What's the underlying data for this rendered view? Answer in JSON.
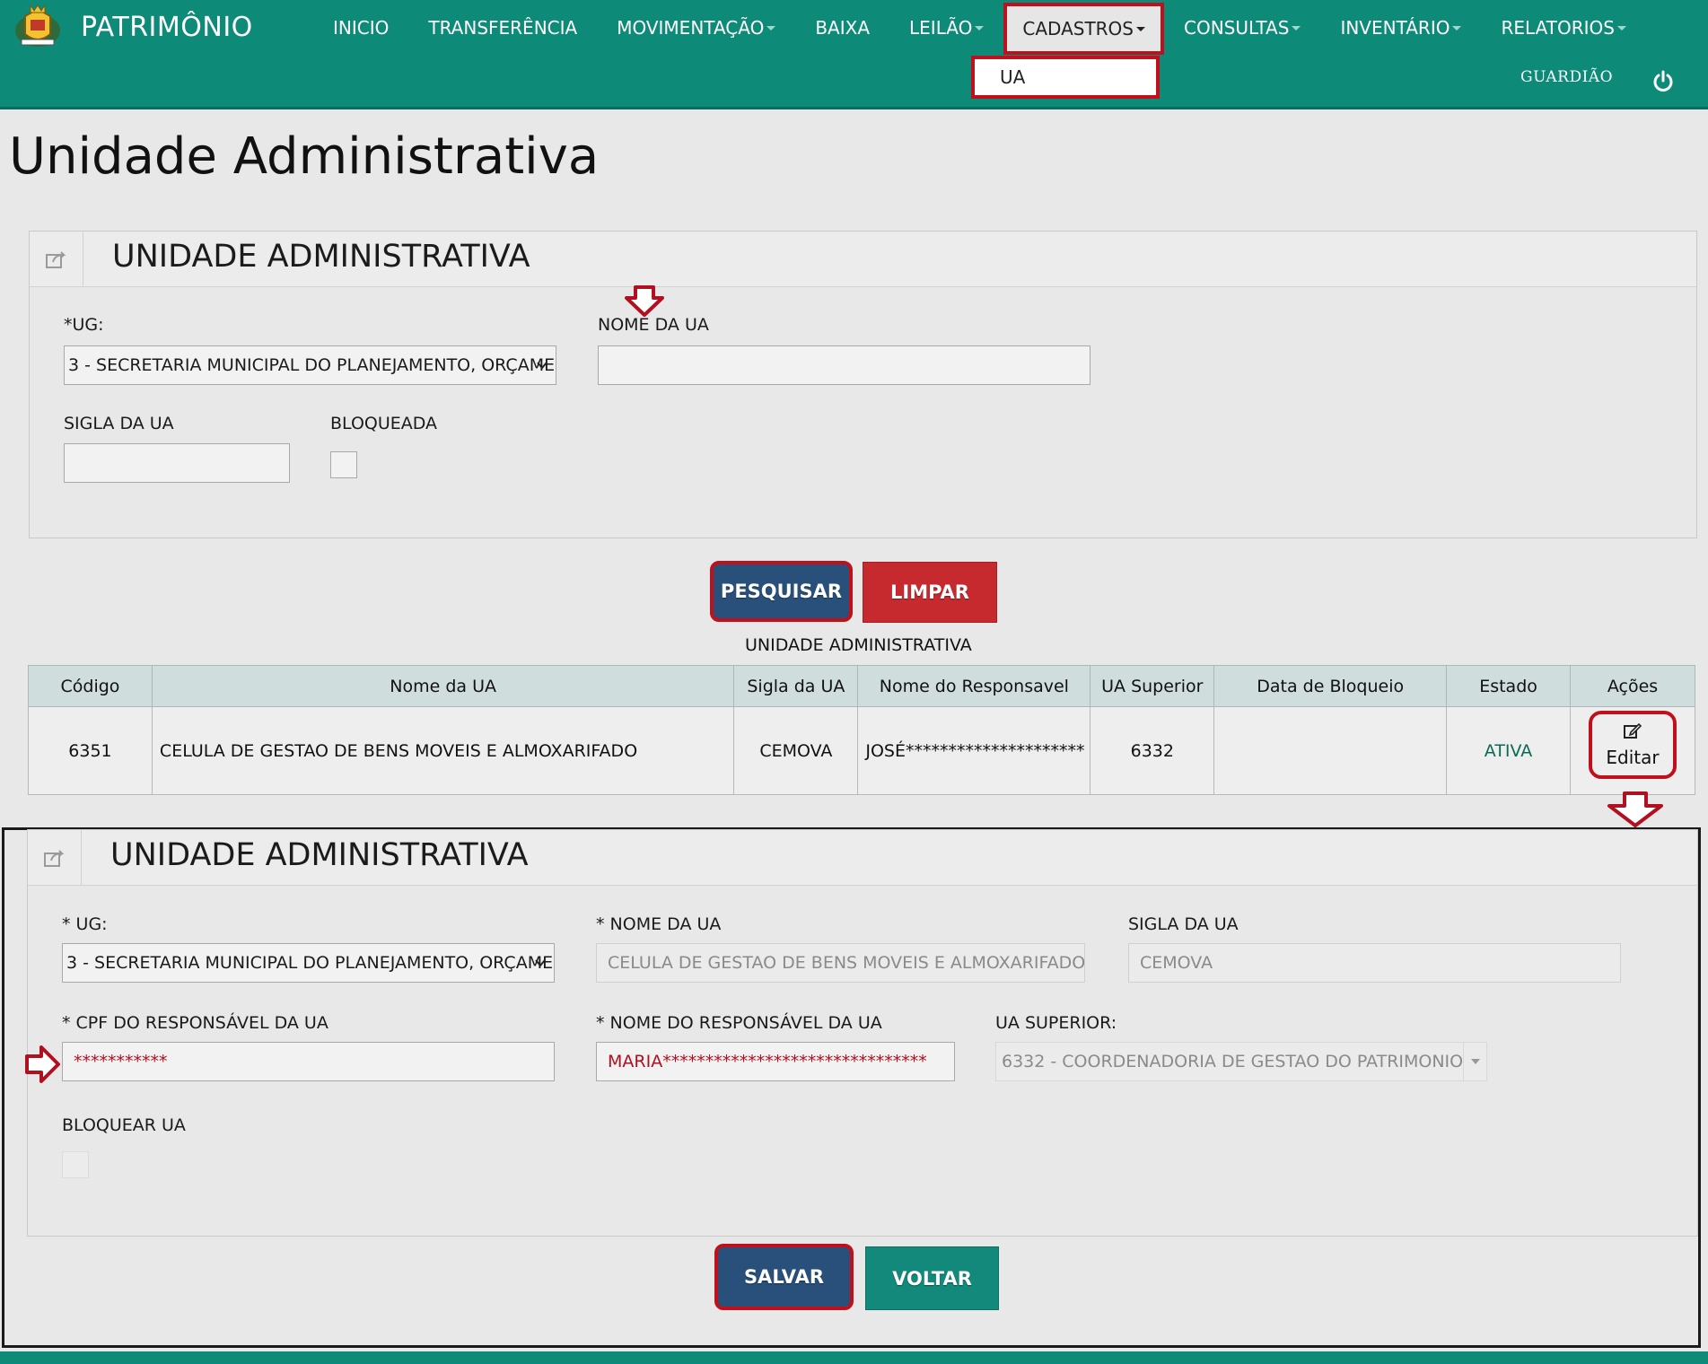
{
  "app": {
    "title": "PATRIMÔNIO",
    "user": "GUARDIÃO"
  },
  "icons": {
    "logo": "municipal-crest-icon",
    "power": "power-icon",
    "panel": "share-icon",
    "edit": "edit-icon"
  },
  "colors": {
    "navbar": "#0e8a78",
    "highlight": "#c0101c",
    "primary": "#28507a",
    "danger": "#c62a2f",
    "teal": "#12897b"
  },
  "nav": {
    "inicio": "INICIO",
    "transferencia": "TRANSFERÊNCIA",
    "movimentacao": "MOVIMENTAÇÃO",
    "baixa": "BAIXA",
    "leilao": "LEILÃO",
    "cadastros": "CADASTROS",
    "consultas": "CONSULTAS",
    "inventario": "INVENTÁRIO",
    "relatorios": "RELATORIOS",
    "cadastros_dropdown": [
      "UA"
    ]
  },
  "page": {
    "title": "Unidade Administrativa"
  },
  "search_panel": {
    "title": "UNIDADE ADMINISTRATIVA",
    "ug_label": "*UG:",
    "ug_value": "3 - SECRETARIA MUNICIPAL DO PLANEJAMENTO, ORÇAME",
    "nome_label": "NOME DA UA",
    "nome_value": "",
    "sigla_label": "SIGLA DA UA",
    "sigla_value": "",
    "bloqueada_label": "BLOQUEADA",
    "bloqueada_checked": false
  },
  "search_buttons": {
    "search": "PESQUISAR",
    "clear": "LIMPAR"
  },
  "results": {
    "caption": "UNIDADE ADMINISTRATIVA",
    "columns": [
      "Código",
      "Nome da UA",
      "Sigla da UA",
      "Nome do Responsavel",
      "UA Superior",
      "Data de Bloqueio",
      "Estado",
      "Ações"
    ],
    "rows": [
      {
        "codigo": "6351",
        "nome": "CELULA DE GESTAO DE BENS MOVEIS E ALMOXARIFADO",
        "sigla": "CEMOVA",
        "responsavel": "JOSÉ*********************",
        "superior": "6332",
        "data_bloqueio": "",
        "estado": "ATIVA",
        "acao": "Editar"
      }
    ]
  },
  "edit_panel": {
    "title": "UNIDADE ADMINISTRATIVA",
    "ug_label": "* UG:",
    "ug_value": "3 - SECRETARIA MUNICIPAL DO PLANEJAMENTO, ORÇAME",
    "nome_label": "* NOME DA UA",
    "nome_value": "CELULA DE GESTAO DE BENS MOVEIS E ALMOXARIFADO",
    "sigla_label": "SIGLA DA UA",
    "sigla_value": "CEMOVA",
    "cpf_label": "* CPF DO RESPONSÁVEL DA UA",
    "cpf_value": "***********",
    "responsavel_label": "* NOME DO RESPONSÁVEL DA UA",
    "responsavel_value": "MARIA*******************************",
    "superior_label": "UA SUPERIOR:",
    "superior_value": "6332 - COORDENADORIA DE GESTAO DO PATRIMONIO",
    "bloquear_label": "BLOQUEAR UA",
    "bloquear_checked": false
  },
  "edit_buttons": {
    "save": "SALVAR",
    "back": "VOLTAR"
  }
}
